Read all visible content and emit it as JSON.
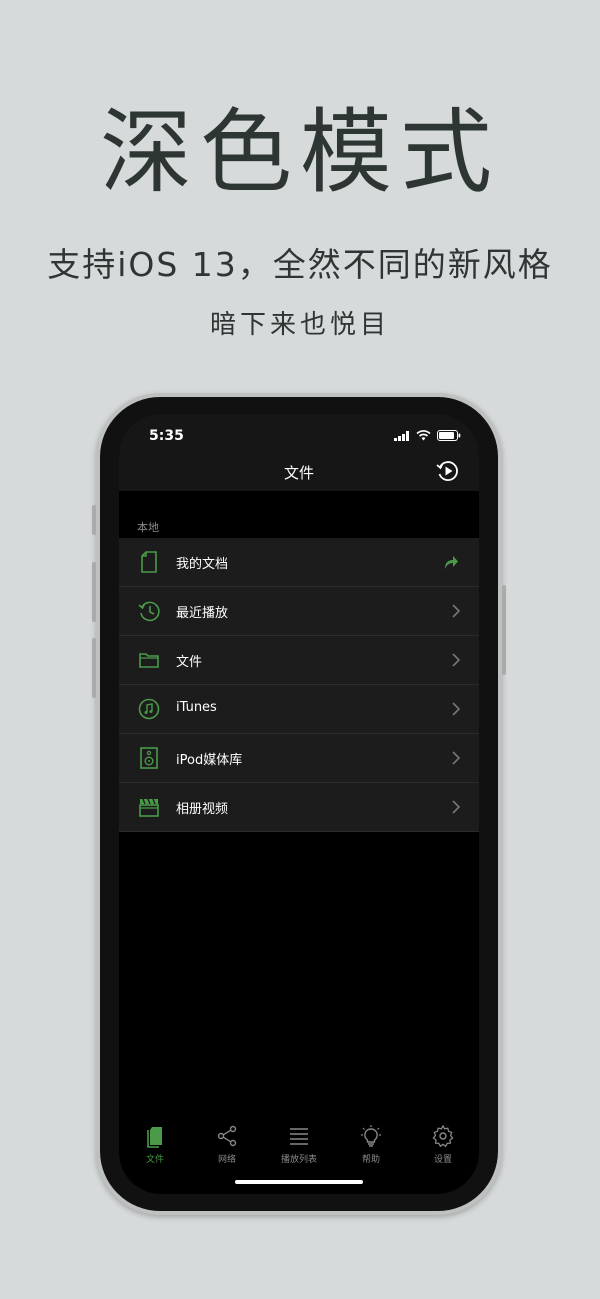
{
  "promo": {
    "headline": "深色模式",
    "subline": "支持iOS 13，全然不同的新风格",
    "subline2": "暗下来也悦目"
  },
  "status_bar": {
    "time": "5:35"
  },
  "nav": {
    "title": "文件"
  },
  "section": {
    "label": "本地"
  },
  "list": {
    "items": [
      {
        "label": "我的文档",
        "icon": "document-icon",
        "accessory": "share-arrow"
      },
      {
        "label": "最近播放",
        "icon": "history-icon",
        "accessory": "chevron"
      },
      {
        "label": "文件",
        "icon": "folder-icon",
        "accessory": "chevron"
      },
      {
        "label": "iTunes",
        "icon": "music-note-icon",
        "accessory": "chevron"
      },
      {
        "label": "iPod媒体库",
        "icon": "speaker-icon",
        "accessory": "chevron"
      },
      {
        "label": "相册视频",
        "icon": "clapperboard-icon",
        "accessory": "chevron"
      }
    ]
  },
  "tabbar": {
    "tabs": [
      {
        "label": "文件",
        "icon": "documents-icon",
        "active": true
      },
      {
        "label": "网络",
        "icon": "share-network-icon",
        "active": false
      },
      {
        "label": "播放列表",
        "icon": "list-icon",
        "active": false
      },
      {
        "label": "帮助",
        "icon": "lightbulb-icon",
        "active": false
      },
      {
        "label": "设置",
        "icon": "gear-icon",
        "active": false
      }
    ]
  },
  "colors": {
    "background": "#d6dadb",
    "accent_green": "#4a9a4a",
    "text_dark": "#2e3633",
    "row_bg": "#1c1c1c"
  }
}
